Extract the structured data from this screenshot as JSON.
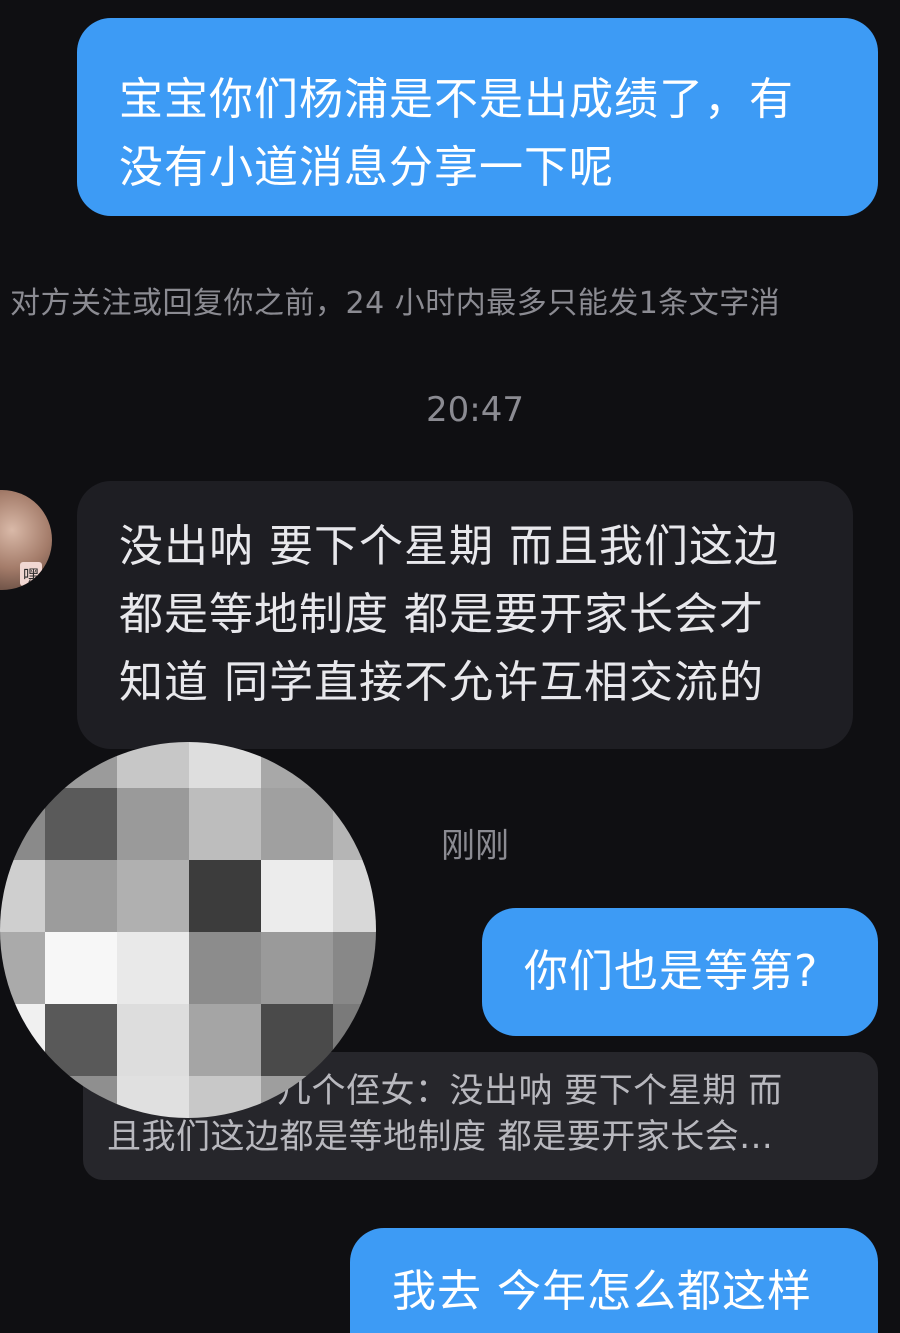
{
  "messages": {
    "sent_1": {
      "line1": "宝宝你们杨浦是不是出成绩了，有",
      "line2": "没有小道消息分享一下呢"
    },
    "notice": "对方关注或回复你之前，24 小时内最多只能发1条文字消",
    "time_1": "20:47",
    "received_1": {
      "line1": "没出呐 要下个星期 而且我们这边",
      "line2": "都是等地制度 都是要开家长会才",
      "line3": "知道 同学直接不允许互相交流的"
    },
    "avatar_badge": "嘿",
    "time_2": "刚刚",
    "sent_2": "你们也是等第?",
    "quote": {
      "line1": "几个侄女：没出呐 要下个星期 而",
      "line2": "且我们这边都是等地制度 都是要开家长会..."
    },
    "sent_3": "我去 今年怎么都这样"
  },
  "colors": {
    "background": "#0f0f12",
    "sent_bubble": "#3d9bf5",
    "received_bubble": "#1e1e23",
    "quote_bubble": "#26262b",
    "muted_text": "#8b8b92"
  },
  "mosaic_tones": [
    "#5e5e5e",
    "#9b9b9b",
    "#c7c7c7",
    "#dedede",
    "#a8a8a8",
    "#6c6c6c",
    "#8a8a8a",
    "#5a5a5a",
    "#9a9a9a",
    "#bdbdbd",
    "#a0a0a0",
    "#b5b5b5",
    "#cfcfcf",
    "#9c9c9c",
    "#b0b0b0",
    "#3c3c3c",
    "#ececec",
    "#d8d8d8",
    "#aaaaaa",
    "#f7f7f7",
    "#e9e9e9",
    "#8c8c8c",
    "#9a9a9a",
    "#888888",
    "#f0f0f0",
    "#595959",
    "#dddddd",
    "#a5a5a5",
    "#4a4a4a",
    "#7a7a7a",
    "#6a6a6a",
    "#8f8f8f",
    "#e0e0e0",
    "#c8c8c8",
    "#9e9e9e",
    "#7c7c7c"
  ]
}
